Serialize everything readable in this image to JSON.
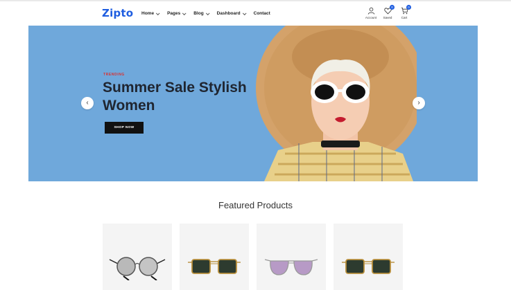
{
  "header": {
    "logo": "Zipto",
    "nav": [
      {
        "label": "Home",
        "dropdown": true
      },
      {
        "label": "Pages",
        "dropdown": true
      },
      {
        "label": "Blog",
        "dropdown": true
      },
      {
        "label": "Dashboard",
        "dropdown": true
      },
      {
        "label": "Contact",
        "dropdown": false
      }
    ],
    "icons": [
      {
        "name": "user-icon",
        "label": "Account",
        "badge": ""
      },
      {
        "name": "heart-icon",
        "label": "Saved",
        "badge": "0"
      },
      {
        "name": "cart-icon",
        "label": "Cart",
        "badge": "0"
      }
    ]
  },
  "hero": {
    "eyebrow": "TRENDING",
    "title": "Summer Sale Stylish Women",
    "button": "SHOP NOW",
    "bg_color": "#6fa8db"
  },
  "featured": {
    "title": "Featured Products",
    "products": [
      {
        "image": "round-sunglasses"
      },
      {
        "image": "square-sunglasses"
      },
      {
        "image": "aviator-sunglasses"
      },
      {
        "image": "square-sunglasses"
      }
    ]
  },
  "colors": {
    "accent": "#1e5de0",
    "trending": "#d9302f"
  }
}
